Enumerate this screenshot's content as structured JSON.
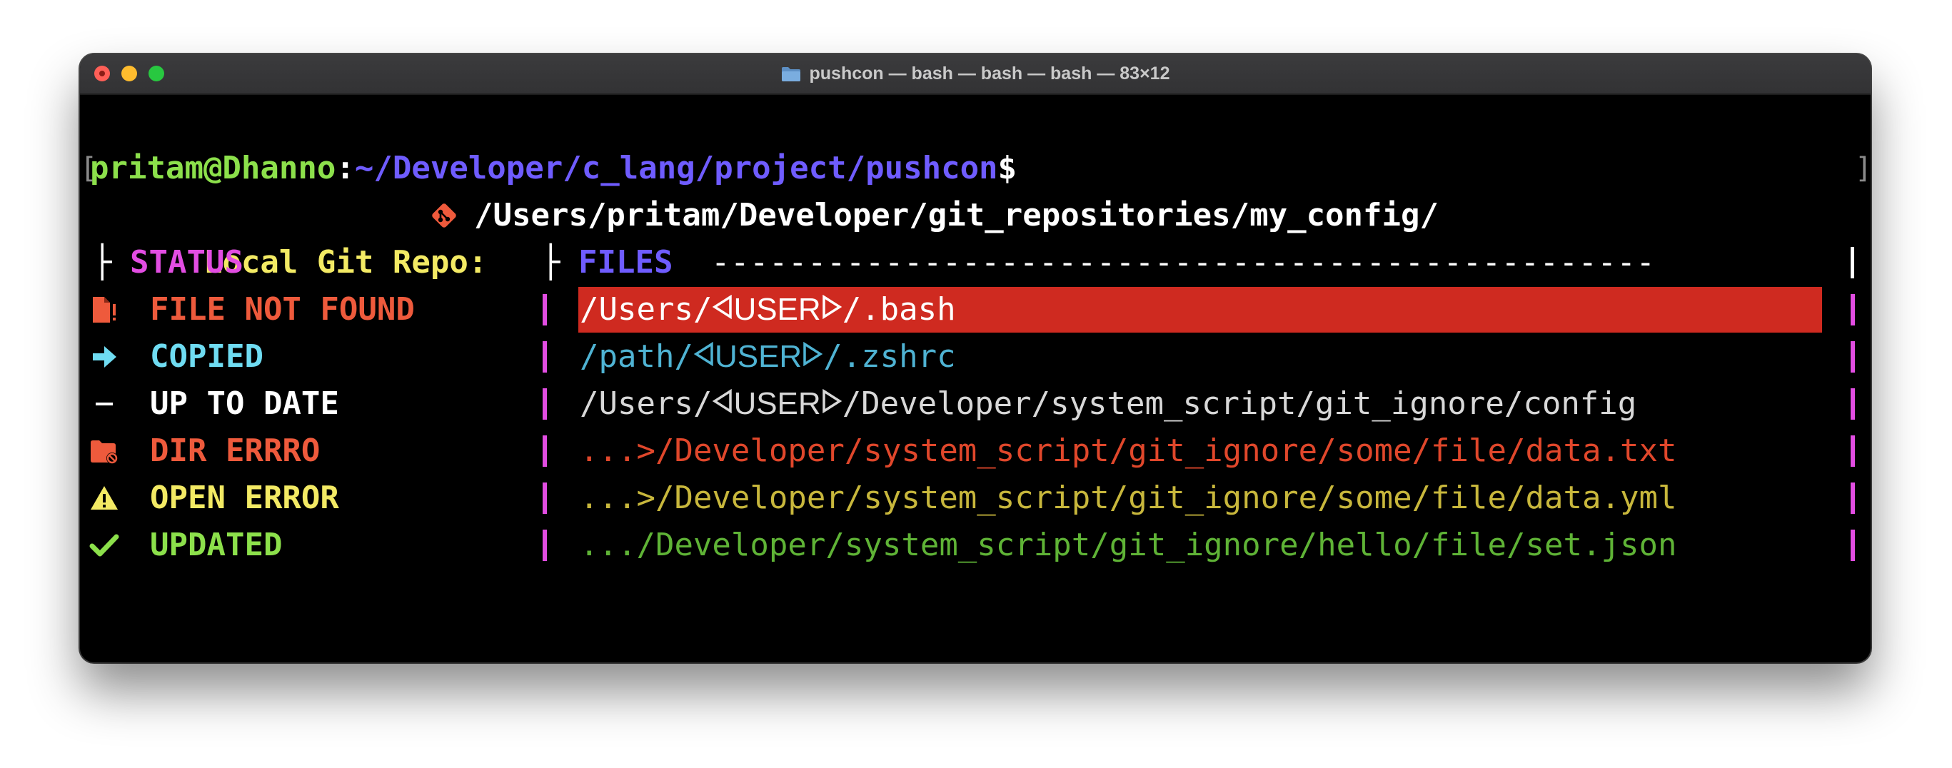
{
  "window": {
    "title": "pushcon — bash — bash — bash — 83×12",
    "title_icon": "folder-icon"
  },
  "prompt": {
    "user_host": "pritam@Dhanno",
    "separator": ":",
    "path": "~/Developer/c_lang/project/pushcon",
    "symbol": "$"
  },
  "repo": {
    "label": "Local Git Repo:",
    "icon": "git-icon",
    "path": "/Users/pritam/Developer/git_repositories/my_config/"
  },
  "headers": {
    "status_prefix": "├",
    "status": "STATUS",
    "files_prefix": "├",
    "files": "FILES",
    "files_rule": "-------------------------------------------------"
  },
  "rows": [
    {
      "icon": "file-alert-icon",
      "status": "FILE NOT FOUND",
      "file_prefix": "/Users/",
      "user_token": "USER",
      "file_suffix": "/.bash",
      "color": "#ee5a3c",
      "file_color": "#ffffff",
      "highlight": "#cf2a20"
    },
    {
      "icon": "arrow-right-icon",
      "status": "COPIED",
      "file_prefix": "/path/",
      "user_token": "USER",
      "file_suffix": "/.zshrc",
      "color": "#6fdcf2",
      "file_color": "#4fb3d3"
    },
    {
      "icon": "dash-icon",
      "status": "UP TO DATE",
      "file_prefix": "/Users/",
      "user_token": "USER",
      "file_suffix": "/Developer/system_script/git_ignore/config",
      "color": "#ffffff",
      "file_color": "#d8d8d8"
    },
    {
      "icon": "folder-error-icon",
      "status": "DIR ERRRO",
      "file_text": "...>/Developer/system_script/git_ignore/some/file/data.txt",
      "color": "#ee5a3c",
      "file_color": "#e0472b"
    },
    {
      "icon": "warning-icon",
      "status": "OPEN ERROR",
      "file_text": "...>/Developer/system_script/git_ignore/some/file/data.yml",
      "color": "#f3ea64",
      "file_color": "#c8b73c"
    },
    {
      "icon": "checkmark-icon",
      "status": "UPDATED",
      "file_text": ".../Developer/system_script/git_ignore/hello/file/set.json",
      "color": "#8ce04b",
      "file_color": "#5fb336"
    }
  ]
}
